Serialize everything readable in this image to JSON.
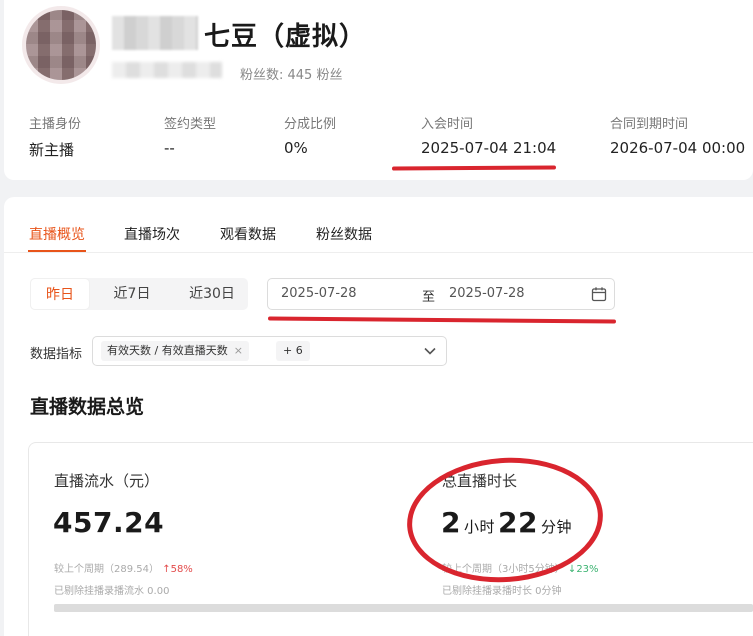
{
  "header": {
    "streamer_name": "七豆（虚拟）",
    "fans_label": "粉丝数: 445 粉丝"
  },
  "contract_info": [
    {
      "label": "主播身份",
      "value": "新主播"
    },
    {
      "label": "签约类型",
      "value": "--"
    },
    {
      "label": "分成比例",
      "value": "0%"
    },
    {
      "label": "入会时间",
      "value": "2025-07-04 21:04"
    },
    {
      "label": "合同到期时间",
      "value": "2026-07-04 00:00"
    }
  ],
  "tabs": [
    {
      "label": "直播概览",
      "active": true
    },
    {
      "label": "直播场次",
      "active": false
    },
    {
      "label": "观看数据",
      "active": false
    },
    {
      "label": "粉丝数据",
      "active": false
    }
  ],
  "date_filter": {
    "quick_options": [
      {
        "label": "昨日",
        "active": true
      },
      {
        "label": "近7日",
        "active": false
      },
      {
        "label": "近30日",
        "active": false
      }
    ],
    "start_date": "2025-07-28",
    "separator": "至",
    "end_date": "2025-07-28",
    "calendar_icon": "calendar-icon"
  },
  "metrics_filter": {
    "label": "数据指标",
    "selected_tag": "有效天数 / 有效直播天数",
    "tag_close": "×",
    "more_count": "+ 6",
    "dropdown_icon": "chevron-down-icon"
  },
  "overview": {
    "title": "直播数据总览",
    "revenue": {
      "label": "直播流水（元）",
      "value": "457.24",
      "compare_label": "较上个周期（289.54）",
      "change": "58%",
      "change_direction": "up",
      "excluded_label": "已剔除挂播录播流水 0.00"
    },
    "duration": {
      "label": "总直播时长",
      "hours": "2",
      "hours_unit": "小时",
      "minutes": "22",
      "minutes_unit": "分钟",
      "compare_label": "较上个周期（3小时5分钟）",
      "change": "23%",
      "change_direction": "down",
      "excluded_label": "已剔除挂播录播时长 0分钟"
    }
  },
  "annotation_color": "#d9252e",
  "accent_color": "#e8541a"
}
